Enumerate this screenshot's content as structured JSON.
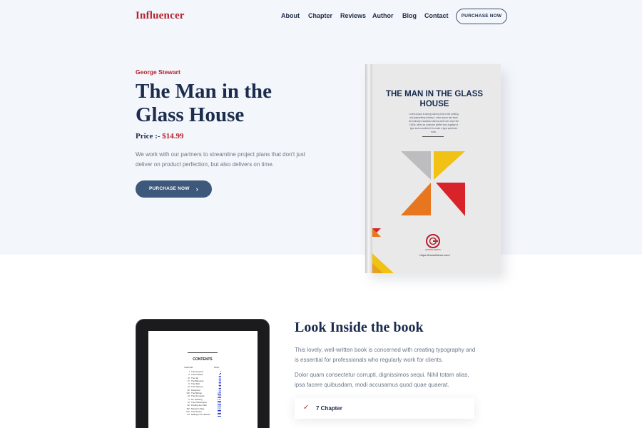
{
  "header": {
    "logo": "Influencer",
    "nav": [
      "About",
      "Chapter",
      "Reviews",
      "Author",
      "Blog",
      "Contact"
    ],
    "cta": "PURCHASE NOW"
  },
  "hero": {
    "author": "George Stewart",
    "title": "The Man in the Glass House",
    "price_label": "Price :-",
    "price": "$14.99",
    "description": "We work with our partners to streamline project plans that don't just deliver on product perfection, but also delivers on time.",
    "button": "PURCHASE NOW"
  },
  "book": {
    "cover_title": "THE MAN IN THE GLASS HOUSE",
    "blurb": "Lorem Ipsum is simply dummy text of the printing and typesetting industry. Lorem Ipsum has been the industry's standard dummy text ever since the 1500s, when an unknown printer took a galley of type and scrambled it to make a type specimen book.",
    "publisher": "GRAPHIC GENIUS",
    "url": "https://themefisher.com/"
  },
  "tablet": {
    "toc_heading": "CONTENTS",
    "col_chapter": "CHAPTER",
    "col_page": "PAGE",
    "chapters": [
      {
        "num": "I",
        "name": "The General",
        "page": "1"
      },
      {
        "num": "II",
        "name": "The Problem",
        "page": "17"
      },
      {
        "num": "III",
        "name": "The Jar",
        "page": "36"
      },
      {
        "num": "IV",
        "name": "The Blessing",
        "page": "48"
      },
      {
        "num": "V",
        "name": "The Well",
        "page": "60"
      },
      {
        "num": "VI",
        "name": "The Serpent",
        "page": "75"
      },
      {
        "num": "VII",
        "name": "Discipline",
        "page": "89"
      },
      {
        "num": "VIII",
        "name": "The Bishop",
        "page": "103"
      },
      {
        "num": "IX",
        "name": "The Romantic",
        "page": "115"
      },
      {
        "num": "X",
        "name": "Mr. Wishing",
        "page": "131"
      },
      {
        "num": "XI",
        "name": "The Philosopher",
        "page": "154"
      },
      {
        "num": "XII",
        "name": "Finding the Path",
        "page": "172"
      },
      {
        "num": "XIII",
        "name": "Mosaic's Way",
        "page": "191"
      },
      {
        "num": "XIV",
        "name": "The Doctor",
        "page": "203"
      },
      {
        "num": "XV",
        "name": "Riding to the Manse",
        "page": "214"
      }
    ]
  },
  "inside": {
    "title": "Look Inside the book",
    "p1": "This lovely, well-written book is concerned with creating typography and is essential for professionals who regularly work for clients.",
    "p2": "Dolor quam consectetur corrupti, dignissimos sequi. Nihil totam alias, ipsa facere quibusdam, modi accusamus quod quae quaerat.",
    "feature": "7 Chapter"
  },
  "colors": {
    "brand_red": "#b5202e",
    "navy": "#1c2c4d",
    "button_blue": "#3d587a",
    "hero_bg": "#f3f6fa"
  },
  "icons": {
    "cta_arrow": "chevron-right-icon",
    "feature_check": "check-icon"
  }
}
